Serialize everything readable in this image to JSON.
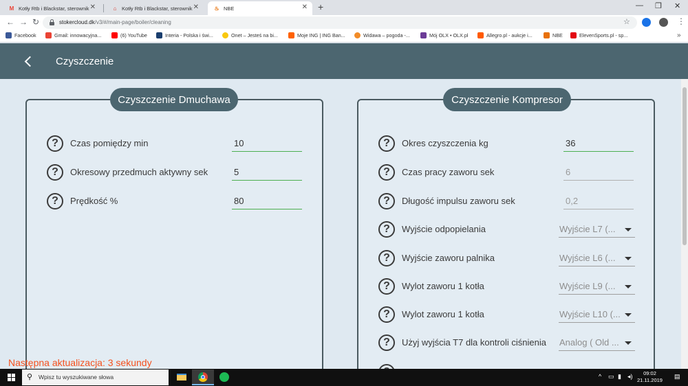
{
  "browser": {
    "tabs": [
      {
        "title": "Kotły Rtb i Blackstar, sterownik w",
        "icon_color": "#ea4335",
        "icon_char": "M"
      },
      {
        "title": "Kotły Rtb i Blackstar, sterownik w",
        "icon_color": "#d93025",
        "icon_char": "⌂"
      },
      {
        "title": "NBE",
        "icon_color": "#e8710a",
        "icon_char": "♨"
      }
    ],
    "url_host": "stokercloud.dk",
    "url_path": "/v3/#/main-page/boiler/cleaning",
    "bookmarks": [
      {
        "label": "Facebook",
        "color": "#3b5998"
      },
      {
        "label": "Gmail: innowacyjna...",
        "color": "#ea4335"
      },
      {
        "label": "(6) YouTube",
        "color": "#ff0000"
      },
      {
        "label": "Interia - Polska i świ...",
        "color": "#1a3e6e"
      },
      {
        "label": "Onet – Jesteś na bi...",
        "color": "#f9c80e"
      },
      {
        "label": "Moje ING | ING Ban...",
        "color": "#ff6200"
      },
      {
        "label": "Widawa – pogoda -...",
        "color": "#f28c28"
      },
      {
        "label": "Mój OLX • OLX.pl",
        "color": "#6c3c97"
      },
      {
        "label": "Allegro.pl - aukcje i...",
        "color": "#ff5a00"
      },
      {
        "label": "NBE",
        "color": "#e8710a"
      },
      {
        "label": "ElevenSports.pl - sp...",
        "color": "#e30613"
      }
    ]
  },
  "app": {
    "title": "Czyszczenie",
    "left_panel": {
      "title": "Czyszczenie Dmuchawa",
      "rows": [
        {
          "label": "Czas pomiędzy min",
          "value": "10"
        },
        {
          "label": "Okresowy przedmuch aktywny sek",
          "value": "5"
        },
        {
          "label": "Prędkość %",
          "value": "80"
        }
      ]
    },
    "right_panel": {
      "title": "Czyszczenie Kompresor",
      "fields": [
        {
          "label": "Okres czyszczenia kg",
          "value": "36"
        },
        {
          "label": "Czas pracy zaworu sek",
          "value": "6"
        },
        {
          "label": "Długość impulsu zaworu sek",
          "value": "0,2"
        }
      ],
      "selects": [
        {
          "label": "Wyjście odpopielania",
          "value": "Wyjście L7 (..."
        },
        {
          "label": "Wyjście zaworu palnika",
          "value": "Wyjście L6 (..."
        },
        {
          "label": "Wylot zaworu 1 kotła",
          "value": "Wyjście L9 (..."
        },
        {
          "label": "Wylot zaworu 1 kotła",
          "value": "Wyjście L10 (..."
        },
        {
          "label": "Użyj wyjścia T7 dla kontroli ciśnienia",
          "value": "Analog ( Old ..."
        }
      ]
    },
    "next_update": "Następna aktualizacja: 3  sekundy",
    "help_glyph": "?"
  },
  "taskbar": {
    "search_placeholder": "Wpisz tu wyszukiwane słowa",
    "time": "09:02",
    "date": "21.11.2019"
  }
}
